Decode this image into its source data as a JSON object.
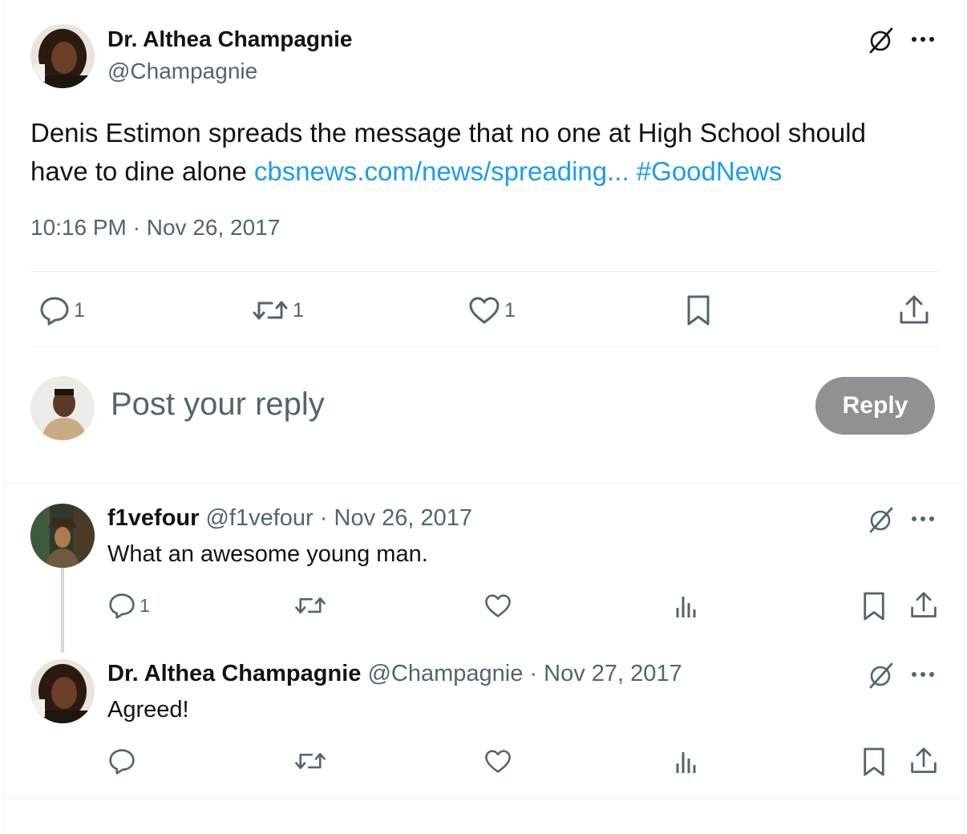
{
  "main_tweet": {
    "author_name": "Dr. Althea Champagnie",
    "author_handle": "@Champagnie",
    "text": "Denis Estimon spreads the message that no one at High School should",
    "text_line2": "have to dine alone ",
    "link": "cbsnews.com/news/spreading...",
    "hashtag": "#GoodNews",
    "timestamp": "10:16 PM · Nov 26, 2017",
    "replies": "1",
    "reposts": "1",
    "likes": "1"
  },
  "composer": {
    "placeholder": "Post your reply",
    "reply_label": "Reply"
  },
  "replies": [
    {
      "author_name": "f1vefour",
      "author_handle": "@f1vefour",
      "date": "· Nov 26, 2017",
      "text": "What an awesome young man.",
      "reply_count": "1"
    },
    {
      "author_name": "Dr. Althea Champagnie",
      "author_handle": "@Champagnie",
      "date": "· Nov 27, 2017",
      "text": "Agreed!",
      "reply_count": ""
    }
  ],
  "icons": {
    "grok": "slashed-circle-icon",
    "more": "more-dots-icon",
    "reply": "reply-bubble-icon",
    "repost": "repost-icon",
    "like": "heart-icon",
    "bookmark": "bookmark-icon",
    "share": "share-icon",
    "views": "views-icon"
  },
  "colors": {
    "link": "#1d9bf0",
    "muted": "#536471",
    "reply_button": "#8f9194"
  }
}
